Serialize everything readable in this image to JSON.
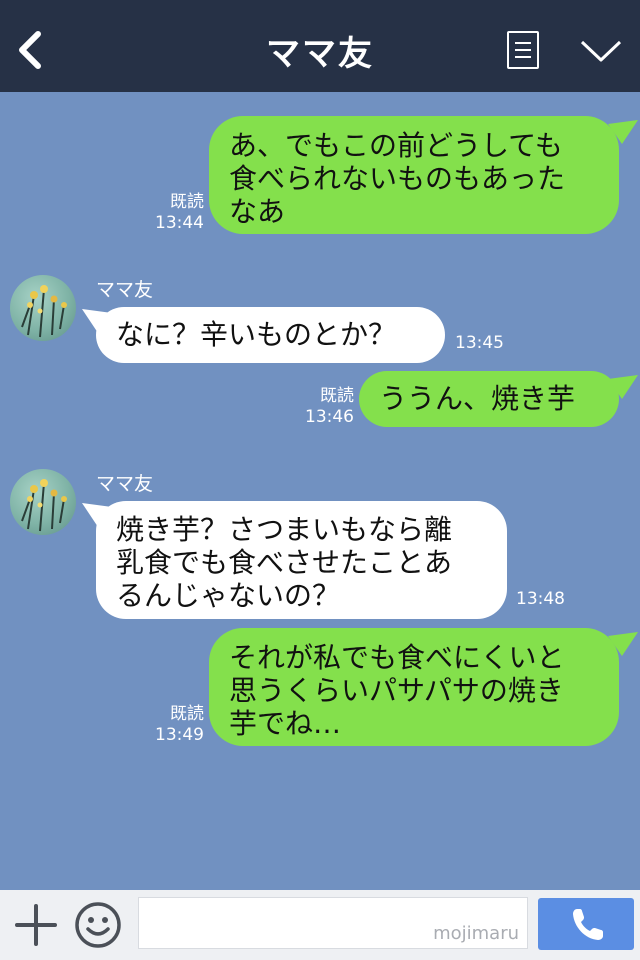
{
  "header": {
    "title": "ママ友"
  },
  "messages": [
    {
      "side": "me",
      "text_lines": [
        "あ、でもこの前どうしても",
        "食べられないものもあった",
        "なあ"
      ],
      "read": "既読",
      "time": "13:44"
    },
    {
      "side": "them",
      "sender": "ママ友",
      "text_lines": [
        "なに？辛いものとか？"
      ],
      "time": "13:45"
    },
    {
      "side": "me",
      "text_lines": [
        "ううん、焼き芋"
      ],
      "read": "既読",
      "time": "13:46"
    },
    {
      "side": "them",
      "sender": "ママ友",
      "text_lines": [
        "焼き芋？さつまいもなら離",
        "乳食でも食べさせたことあ",
        "るんじゃないの？"
      ],
      "time": "13:48"
    },
    {
      "side": "me",
      "text_lines": [
        "それが私でも食べにくいと",
        "思うくらいパサパサの焼き",
        "芋でね…"
      ],
      "read": "既読",
      "time": "13:49"
    }
  ],
  "input": {
    "watermark": "mojimaru"
  },
  "icons": {
    "back": "chevron-left-icon",
    "menu": "notes-icon",
    "dropdown": "chevron-down-icon",
    "add": "plus-icon",
    "emoji": "smiley-icon",
    "call": "phone-icon"
  },
  "colors": {
    "header_bg": "#263146",
    "chat_bg": "#7191c1",
    "my_bubble": "#84e04c",
    "their_bubble": "#ffffff",
    "call_button": "#5b8ee3"
  }
}
